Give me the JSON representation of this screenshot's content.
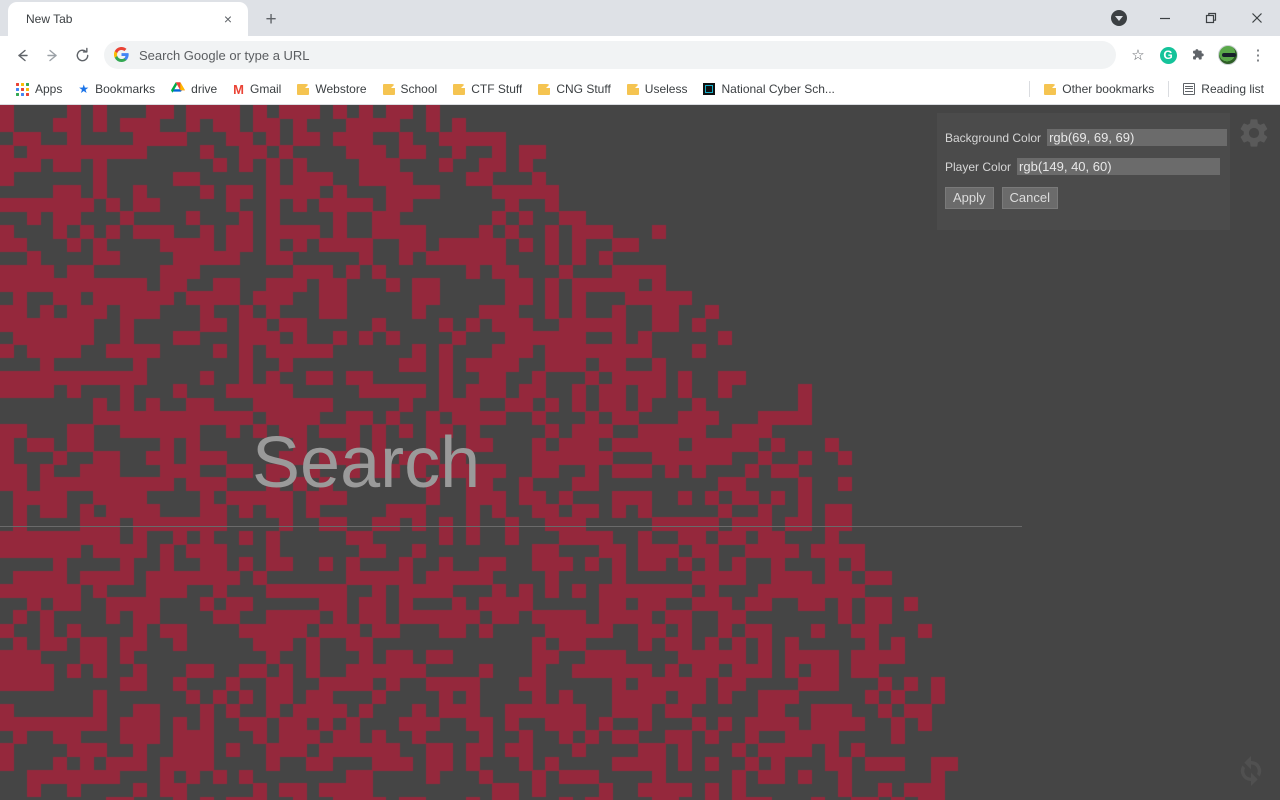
{
  "browser": {
    "tab": {
      "title": "New Tab",
      "close_label": "×"
    },
    "new_tab_label": "+",
    "window_controls": {
      "tab_search": "tab-search",
      "minimize": "—",
      "maximize": "❐",
      "close": "✕"
    },
    "toolbar": {
      "back": "←",
      "forward": "→",
      "reload": "⟳",
      "omnibox_placeholder": "Search Google or type a URL",
      "omnibox_value": "",
      "google_g": "G",
      "star": "☆",
      "grammarly": "G",
      "extensions": "puzzle",
      "menu": "⋮"
    },
    "bookmarks": {
      "apps_label": "Apps",
      "items": [
        {
          "label": "Bookmarks",
          "icon": "star-icon"
        },
        {
          "label": "drive",
          "icon": "drive-icon"
        },
        {
          "label": "Gmail",
          "icon": "gmail-icon"
        },
        {
          "label": "Webstore",
          "icon": "folder-icon"
        },
        {
          "label": "School",
          "icon": "folder-icon"
        },
        {
          "label": "CTF Stuff",
          "icon": "folder-icon"
        },
        {
          "label": "CNG Stuff",
          "icon": "folder-icon"
        },
        {
          "label": "Useless",
          "icon": "folder-icon"
        },
        {
          "label": "National Cyber Sch...",
          "icon": "ncs-icon"
        }
      ],
      "other_bookmarks": "Other bookmarks",
      "reading_list": "Reading list"
    }
  },
  "page": {
    "background_color": "#454545",
    "maze_color": "#95283c",
    "search": {
      "placeholder": "Search",
      "value": ""
    },
    "gear_icon": "gear-icon",
    "reset_icon": "refresh-icon",
    "settings": {
      "background_color_label": "Background Color",
      "background_color_value": "rgb(69, 69, 69)",
      "player_color_label": "Player Color",
      "player_color_value": "rgb(149, 40, 60)",
      "apply_label": "Apply",
      "cancel_label": "Cancel"
    }
  }
}
